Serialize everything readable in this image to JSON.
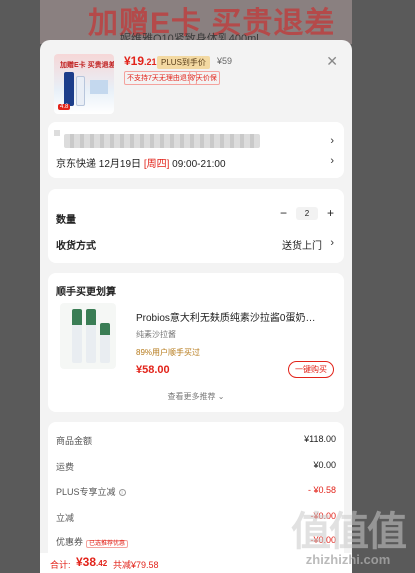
{
  "background": {
    "banner_title": "加赠E卡 买贵退差",
    "banner_subtitle": "妮维雅Q10紧致身体乳400ml"
  },
  "product": {
    "thumb_text": "加赠E卡 买贵退差",
    "thumb_tag": "4.8",
    "price_int": "¥19",
    "price_dec": ".21",
    "plus_badge": "PLUS到手价",
    "original_price": "¥59",
    "chips": [
      "不支持7天无理由退货",
      "7天价保"
    ],
    "close_icon": "close-icon"
  },
  "address": {
    "shipping_carrier": "京东快递",
    "shipping_date": "12月19日",
    "shipping_weekday": "[周四]",
    "shipping_time": "09:00-21:00"
  },
  "order": {
    "quantity_label": "数量",
    "quantity_value": "2",
    "minus": "−",
    "plus": "+",
    "delivery_label": "收货方式",
    "delivery_value": "送货上门"
  },
  "recommend": {
    "heading": "顺手买更划算",
    "title": "Probios意大利无麸质纯素沙拉酱0蛋奶…",
    "subtitle": "纯素沙拉酱",
    "percent": "89%用户顺手买过",
    "price": "¥58.00",
    "buy_button": "一键购买",
    "more": "查看更多推荐 ⌄"
  },
  "fees": {
    "items": [
      {
        "label": "商品金额",
        "value": "¥118.00",
        "red": false
      },
      {
        "label": "运费",
        "value": "¥0.00",
        "red": false
      },
      {
        "label": "PLUS专享立减",
        "value": "- ¥0.58",
        "red": true
      },
      {
        "label": "立减",
        "value": "-¥0.00",
        "red": true
      },
      {
        "label": "优惠券",
        "value": "-¥0.00",
        "red": true
      }
    ],
    "coupon_tag": "已选推荐优惠"
  },
  "total": {
    "label": "合计:",
    "amount_int": "¥38",
    "amount_dec": ".42",
    "saved": "共减¥79.58"
  },
  "watermark": {
    "glyphs": "值值值",
    "site": "zhizhizhi.com"
  }
}
